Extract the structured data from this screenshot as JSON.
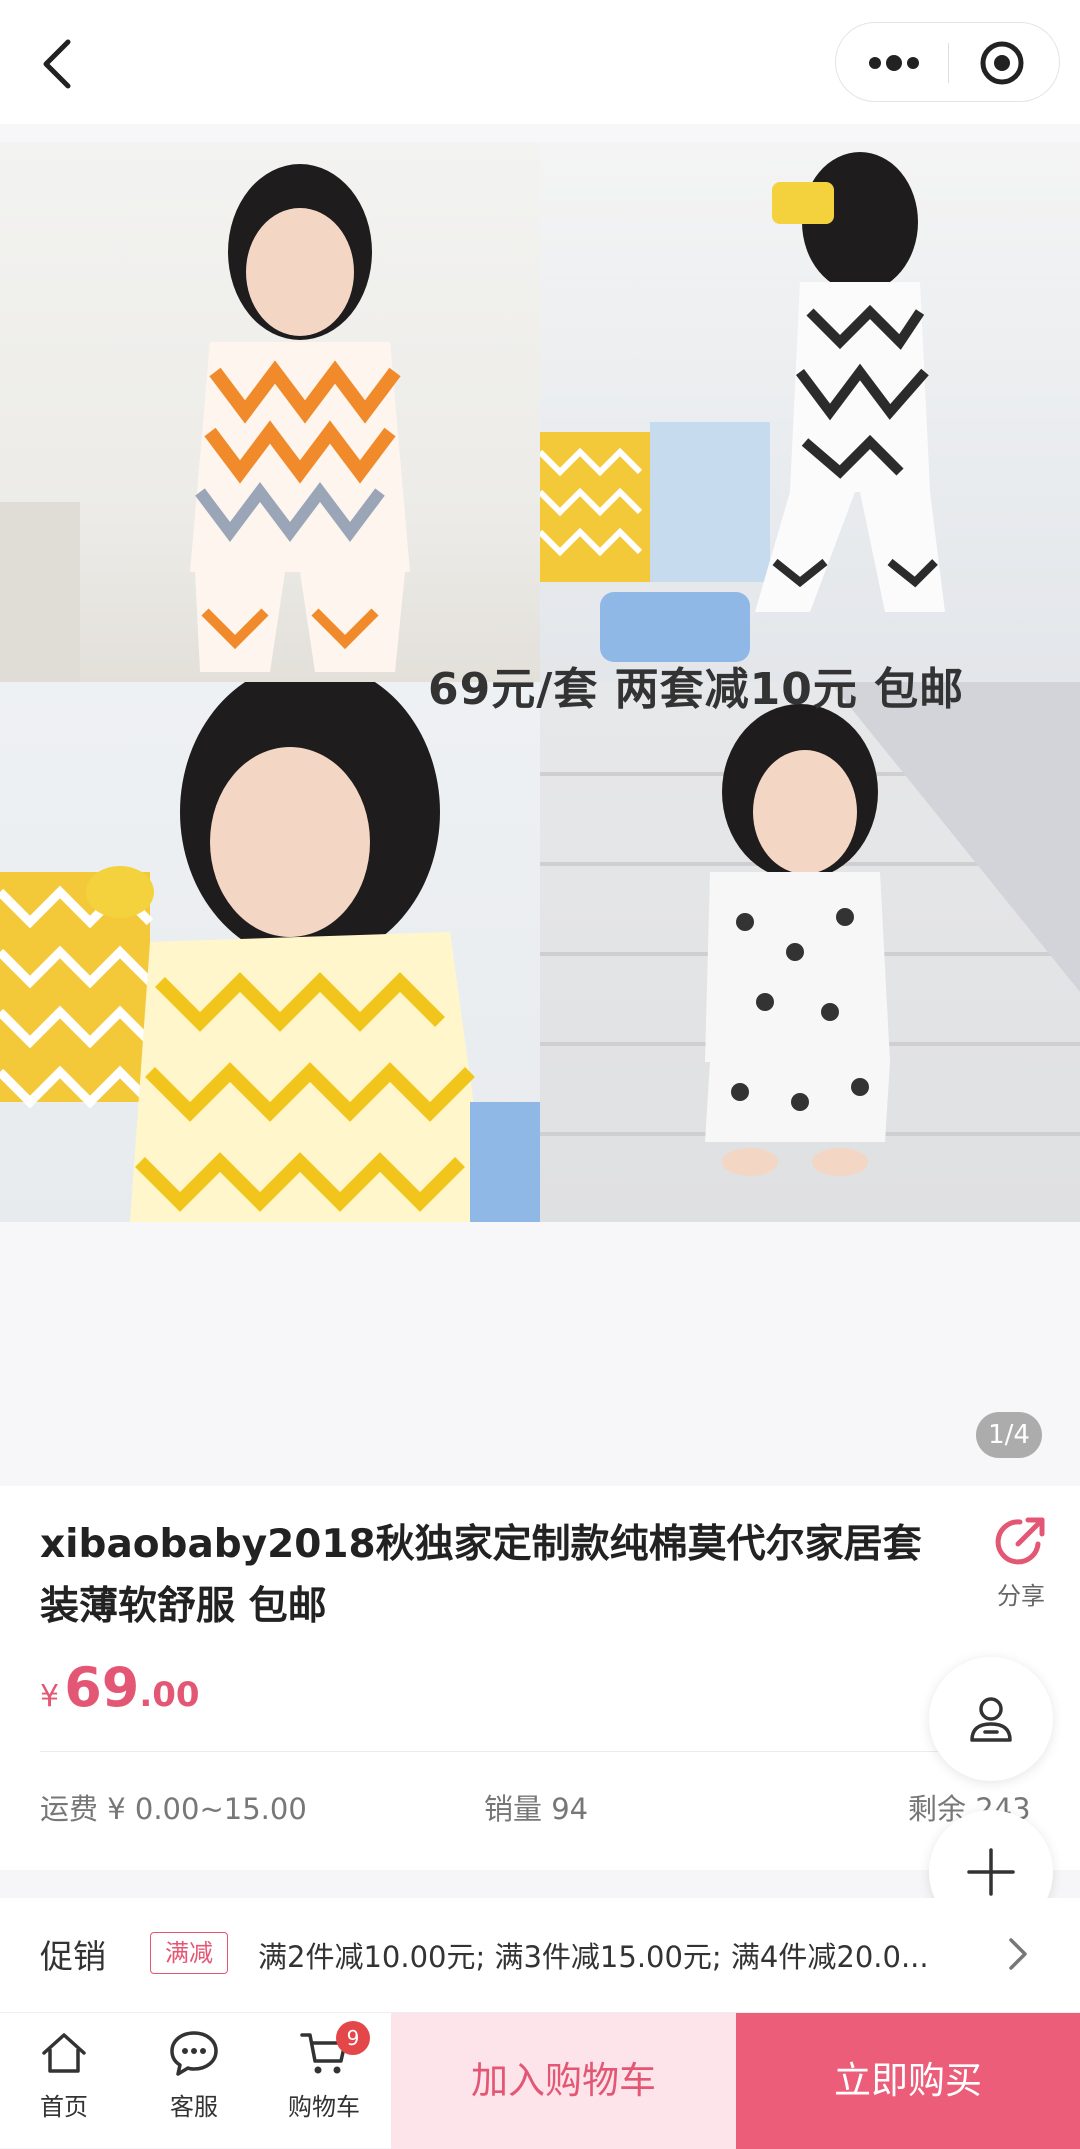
{
  "nav": {
    "back_icon": "chevron-left-icon",
    "more_icon": "more-dots-icon",
    "close_icon": "target-circle-icon"
  },
  "gallery": {
    "overlay_text": "69元/套  两套减10元    包邮",
    "indicator": "1/4"
  },
  "product": {
    "title": "xibaobaby2018秋独家定制款纯棉莫代尔家居套装薄软舒服 包邮",
    "share_label": "分享",
    "price": {
      "symbol": "¥",
      "integer": "69",
      "decimal": ".00"
    },
    "shipping": "运费 ¥ 0.00~15.00",
    "sales": "销量 94",
    "stock": "剩余 243"
  },
  "promo": {
    "label": "促销",
    "tag": "满减",
    "text": "满2件减10.00元; 满3件减15.00元; 满4件减20.0..."
  },
  "bottom": {
    "home": "首页",
    "service": "客服",
    "cart": "购物车",
    "cart_badge": "9",
    "add_to_cart": "加入购物车",
    "buy_now": "立即购买"
  },
  "colors": {
    "accent": "#e45774",
    "buy_button": "#ec5d7a",
    "cart_button_bg": "#fce4ea"
  }
}
